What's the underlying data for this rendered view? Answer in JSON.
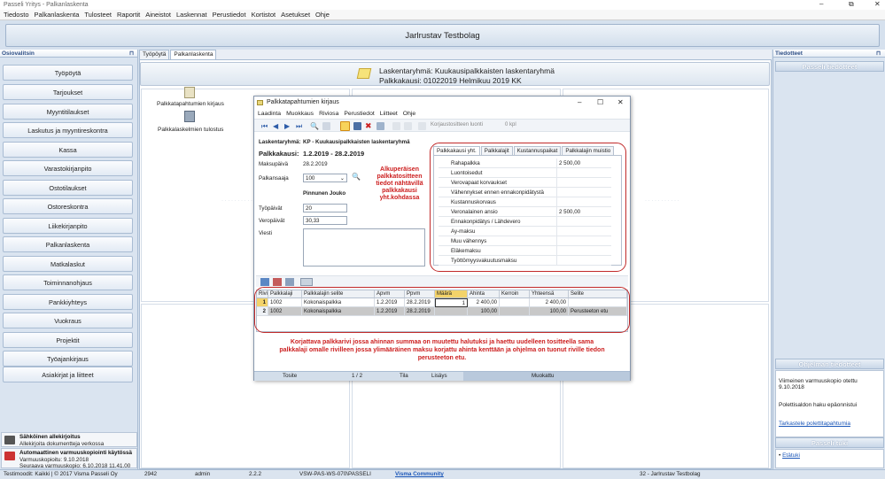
{
  "window": {
    "title": "Passeli Yritys - Palkanlaskenta",
    "controls": [
      "–",
      "⧉",
      "✕"
    ]
  },
  "menu": [
    "Tiedosto",
    "Palkanlaskenta",
    "Tulosteet",
    "Raportit",
    "Aineistot",
    "Laskennat",
    "Perustiedot",
    "Kortistot",
    "Asetukset",
    "Ohje"
  ],
  "banner": "Jarlrustav Testbolag",
  "left": {
    "header": "Osiovalitsin",
    "items": [
      "Työpöytä",
      "Tarjoukset",
      "Myyntitilaukset",
      "Laskutus ja myyntireskontra",
      "Kassa",
      "Varastokirjanpito",
      "Ostotilaukset",
      "Ostoreskontra",
      "Liikekirjanpito",
      "Palkanlaskenta",
      "Matkalaskut",
      "Toiminnanohjaus",
      "Pankkiyhteys",
      "Vuokraus",
      "Projektit",
      "Työajankirjaus",
      "Asiakirjat ja liitteet"
    ],
    "notice1": {
      "title": "Sähköinen allekirjoitus",
      "text": "Allekirjoita dokumentteja verkossa"
    },
    "notice2": {
      "title": "Automaattinen varmuuskopiointi käytössä",
      "line1": "Varmuuskopioitu: 9.10.2018",
      "line2": "Seuraava varmuuskopio: 6.10.2018 11.41.00"
    }
  },
  "center": {
    "tabs": [
      "Työpöytä",
      "Palkanlaskenta"
    ],
    "group_line1": "Laskentaryhmä: Kuukausipalkkaisten laskentaryhmä",
    "group_line2": "Palkkakausi: 01022019 Helmikuu 2019 KK",
    "tool1": "Palkkatapahtumien kirjaus",
    "tool2": "Palkkalaskelmien tulostus"
  },
  "right": {
    "header": "Tiedotteet",
    "h1": "Passeli tiedotteet",
    "h2": "Ohjelman tiedotteet",
    "msg1": "Viimeinen varmuuskopio otettu 9.10.2018",
    "msg2": "Polettisaldon haku epäonnistui",
    "link1": "Tarkastele polettitapahtumia",
    "h3": "Passeli tuki",
    "link2": "Etätuki"
  },
  "status": {
    "left": "Testimoodit: Kaikki | © 2017 Visma Passeli Oy",
    "num": "2942",
    "user": "admin",
    "ver": "2.2.2",
    "host": "VSW-PAS-WS-070\\PASSELI",
    "community": "Visma Community",
    "company": "32 - Jarlrustav Testbolag"
  },
  "dialog": {
    "title": "Palkkatapahtumien kirjaus",
    "menu": [
      "Laadinta",
      "Muokkaus",
      "Riviosa",
      "Perustiedot",
      "Liitteet",
      "Ohje"
    ],
    "toolbar": {
      "korjaus": "Korjaustositteen luonti",
      "count": "0 kpl"
    },
    "laskentaryhma_label": "Laskentaryhmä:",
    "laskentaryhma": "KP - Kuukausipalkkaisten laskentaryhmä",
    "palkkakausi_label": "Palkkakausi:",
    "palkkakausi": "1.2.2019 - 28.2.2019",
    "maksupaiva_label": "Maksupäivä",
    "maksupaiva": "28.2.2019",
    "palkansaaja_label": "Palkansaaja",
    "palkansaaja": "100",
    "employee": "Pinnunen Jouko",
    "tyopaivat_label": "Työpäivät",
    "tyopaivat": "20",
    "veropaivat_label": "Veropäivät",
    "veropaivat": "30,33",
    "viesti_label": "Viesti",
    "note1": "Alkuperäisen palkkatositteen tiedot nähtävillä palkkakausi yht.kohdassa",
    "tabs": [
      "Palkkakausi yht.",
      "Palkkalajit",
      "Kustannuspaikat",
      "Palkkalajin muistio"
    ],
    "summary": [
      {
        "name": "Rahapalkka",
        "value": "2 500,00"
      },
      {
        "name": "Luontoisedut",
        "value": ""
      },
      {
        "name": "Verovapaat korvaukset",
        "value": ""
      },
      {
        "name": "Vähennykset ennen ennakonpidätystä",
        "value": ""
      },
      {
        "name": "Kustannuskorvaus",
        "value": ""
      },
      {
        "name": "Veronalainen ansio",
        "value": "2 500,00"
      },
      {
        "name": "Ennakonpidätys / Lähdevero",
        "value": ""
      },
      {
        "name": "Ay-maksu",
        "value": ""
      },
      {
        "name": "Muu vähennys",
        "value": ""
      },
      {
        "name": "Eläkemaksu",
        "value": ""
      },
      {
        "name": "Työttömyysvakuutusmaksu",
        "value": ""
      }
    ],
    "grid": {
      "headers": [
        "Rivi",
        "Palkkalaji",
        "Palkkalajin selite",
        "Apvm",
        "Ppvm",
        "Määrä",
        "Ahinta",
        "Kerroin",
        "Yhteensä",
        "Selite"
      ],
      "rows": [
        [
          "1",
          "1002",
          "Kokonaispalkka",
          "1.2.2019",
          "28.2.2019",
          "1",
          "2 400,00",
          "",
          "2 400,00",
          ""
        ],
        [
          "2",
          "1002",
          "Kokonaispalkka",
          "1.2.2019",
          "28.2.2019",
          "",
          "100,00",
          "",
          "100,00",
          "Perusteeton etu"
        ]
      ]
    },
    "note2": "Korjattava palkkarivi jossa ahinnan summaa on muutettu halutuksi ja haettu uudelleen tositteella sama palkkalaji omalle rivilleen jossa ylimääräinen maksu korjattu ahinta kenttään ja ohjelma on tuonut riville tiedon perusteeton etu.",
    "status": [
      "Tosite",
      "1 / 2",
      "Tila",
      "Lisäys",
      "Muokattu"
    ]
  }
}
